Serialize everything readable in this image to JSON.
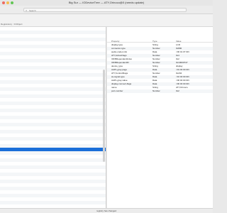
{
  "window": {
    "title": "Big Sur — IODeviceTree — ATY,Orinoco@0 (needs update)"
  },
  "search": {
    "placeholder": "Search"
  },
  "breadcrumb": "Registratory : IOObject",
  "properties": {
    "headers": {
      "key": "Property",
      "type": "Type",
      "value": "Value"
    },
    "rows": [
      {
        "key": "display-type",
        "type": "String",
        "value": "LCD"
      },
      {
        "key": "connector-type",
        "type": "Number",
        "value": "0x800"
      },
      {
        "key": "audio-codec-info",
        "type": "Data",
        "value": "<00 01 07 00>"
      },
      {
        "key": "ATY,ActiveFlags",
        "type": "Number",
        "value": "0x4"
      },
      {
        "key": "IOFBDependentIndex",
        "type": "Number",
        "value": "0x2"
      },
      {
        "key": "IOFBDependentID",
        "type": "Number",
        "value": "0x10000747"
      },
      {
        "key": "device_type",
        "type": "String",
        "value": "display"
      },
      {
        "key": "AAPL,gray-page",
        "type": "Data",
        "value": "<01 00 00 00>"
      },
      {
        "key": "ATY,ControlFlags",
        "type": "Number",
        "value": "0x204"
      },
      {
        "key": "av-signal-type",
        "type": "Data",
        "value": "<10 00 00 00>"
      },
      {
        "key": "AAPL,gray-value",
        "type": "Data",
        "value": "<00 00 00 00>"
      },
      {
        "key": "display-connect-flags",
        "type": "Data",
        "value": "<00 00 00 00>"
      },
      {
        "key": "name",
        "type": "String",
        "value": "ATY,Orinoco"
      },
      {
        "key": "port-number",
        "type": "Number",
        "value": "0x2"
      }
    ]
  },
  "status": {
    "message": "registry has changed"
  },
  "colors": {
    "selection": "#1a6ed8",
    "close": "#ee6a5f",
    "minimize": "#f5be4f",
    "maximize": "#62c554"
  }
}
